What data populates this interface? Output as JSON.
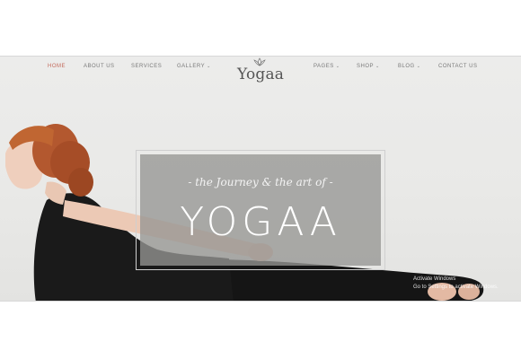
{
  "nav": {
    "home": "HOME",
    "about": "ABOUT US",
    "services": "SERVICES",
    "gallery": "GALLERY",
    "pages": "PAGES",
    "shop": "SHOP",
    "blog": "BLOG",
    "contact": "CONTACT US",
    "caret": "⌄"
  },
  "logo": {
    "text": "Yogaa",
    "icon": "lotus-icon"
  },
  "hero": {
    "tagline": "- the Journey & the art of -",
    "title": "YOGAA"
  },
  "watermark": {
    "line1": "Activate Windows",
    "line2": "Go to Settings to activate Windows."
  },
  "colors": {
    "accent": "#c46a5c",
    "nav_text": "#7a7a7a",
    "hero_box": "#969694"
  }
}
